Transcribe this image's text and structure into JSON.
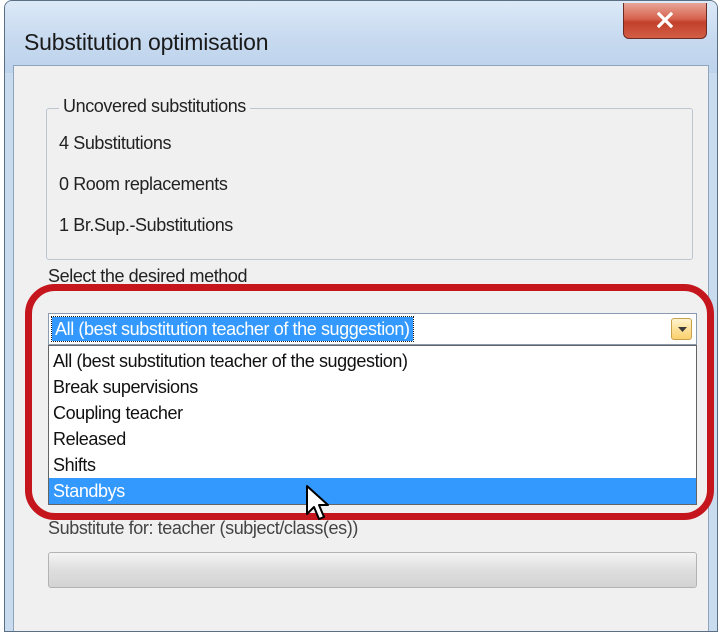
{
  "window": {
    "title": "Substitution optimisation",
    "close_label": "x"
  },
  "uncovered": {
    "legend": "Uncovered substitutions",
    "items": [
      "4 Substitutions",
      "0 Room replacements",
      "1 Br.Sup.-Substitutions"
    ]
  },
  "method": {
    "label": "Select the desired method",
    "selected": "All (best substitution teacher of the suggestion)",
    "options": [
      "All (best substitution teacher of the suggestion)",
      "Break supervisions",
      "Coupling teacher",
      "Released",
      "Shifts",
      "Standbys"
    ],
    "highlighted_option": "Standbys",
    "dropdown_open": true
  },
  "substitute": {
    "label": "Substitute for: teacher (subject/class(es))",
    "progress": 0
  },
  "icons": {
    "close": "close-icon",
    "dropdown_arrow": "chevron-down-icon",
    "cursor": "mouse-pointer-icon"
  },
  "colors": {
    "selection": "#3399ff",
    "highlight_ring": "#c4161c",
    "close_button": "#c2402b"
  }
}
